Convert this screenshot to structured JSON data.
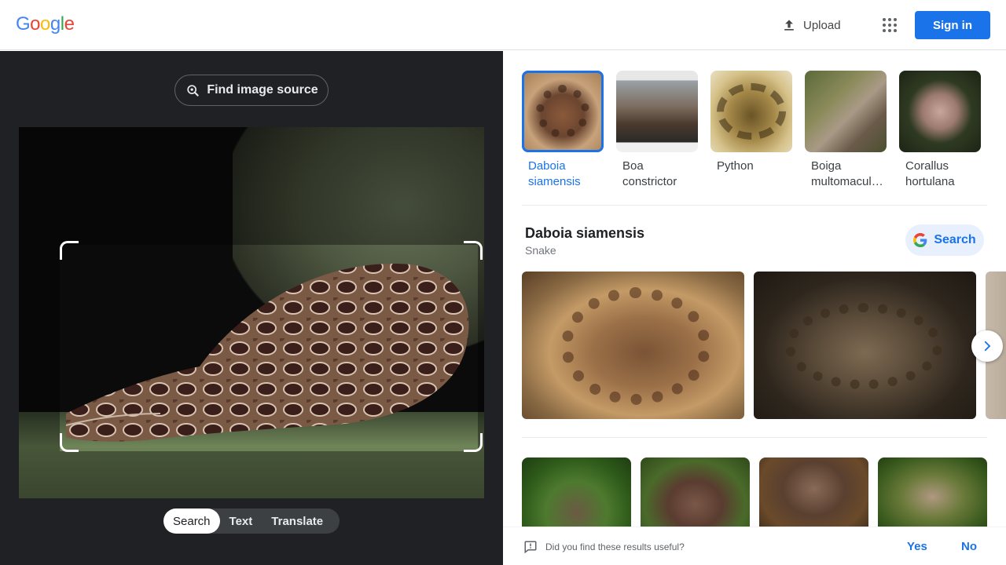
{
  "header": {
    "logo_letters": [
      "G",
      "o",
      "o",
      "g",
      "l",
      "e"
    ],
    "logo_colors": [
      "#4285F4",
      "#EA4335",
      "#FBBC05",
      "#4285F4",
      "#34A853",
      "#EA4335"
    ],
    "upload_label": "Upload",
    "apps_icon": "apps-grid-icon",
    "signin_label": "Sign in"
  },
  "left_panel": {
    "find_source_label": "Find image source",
    "modes": [
      "Search",
      "Text",
      "Translate"
    ],
    "active_mode": "Search"
  },
  "visual_matches": {
    "entities": [
      {
        "label": "Daboia siamensis",
        "active": true
      },
      {
        "label": "Boa constrictor",
        "active": false
      },
      {
        "label": "Python",
        "active": false
      },
      {
        "label": "Boiga multomacula...",
        "active": false
      },
      {
        "label": "Corallus hortulana",
        "active": false
      }
    ]
  },
  "knowledge": {
    "title": "Daboia siamensis",
    "subtitle": "Snake",
    "search_label": "Search"
  },
  "feedback": {
    "question": "Did you find these results useful?",
    "yes": "Yes",
    "no": "No"
  },
  "colors": {
    "accent": "#1a73e8",
    "left_bg": "#202124"
  }
}
